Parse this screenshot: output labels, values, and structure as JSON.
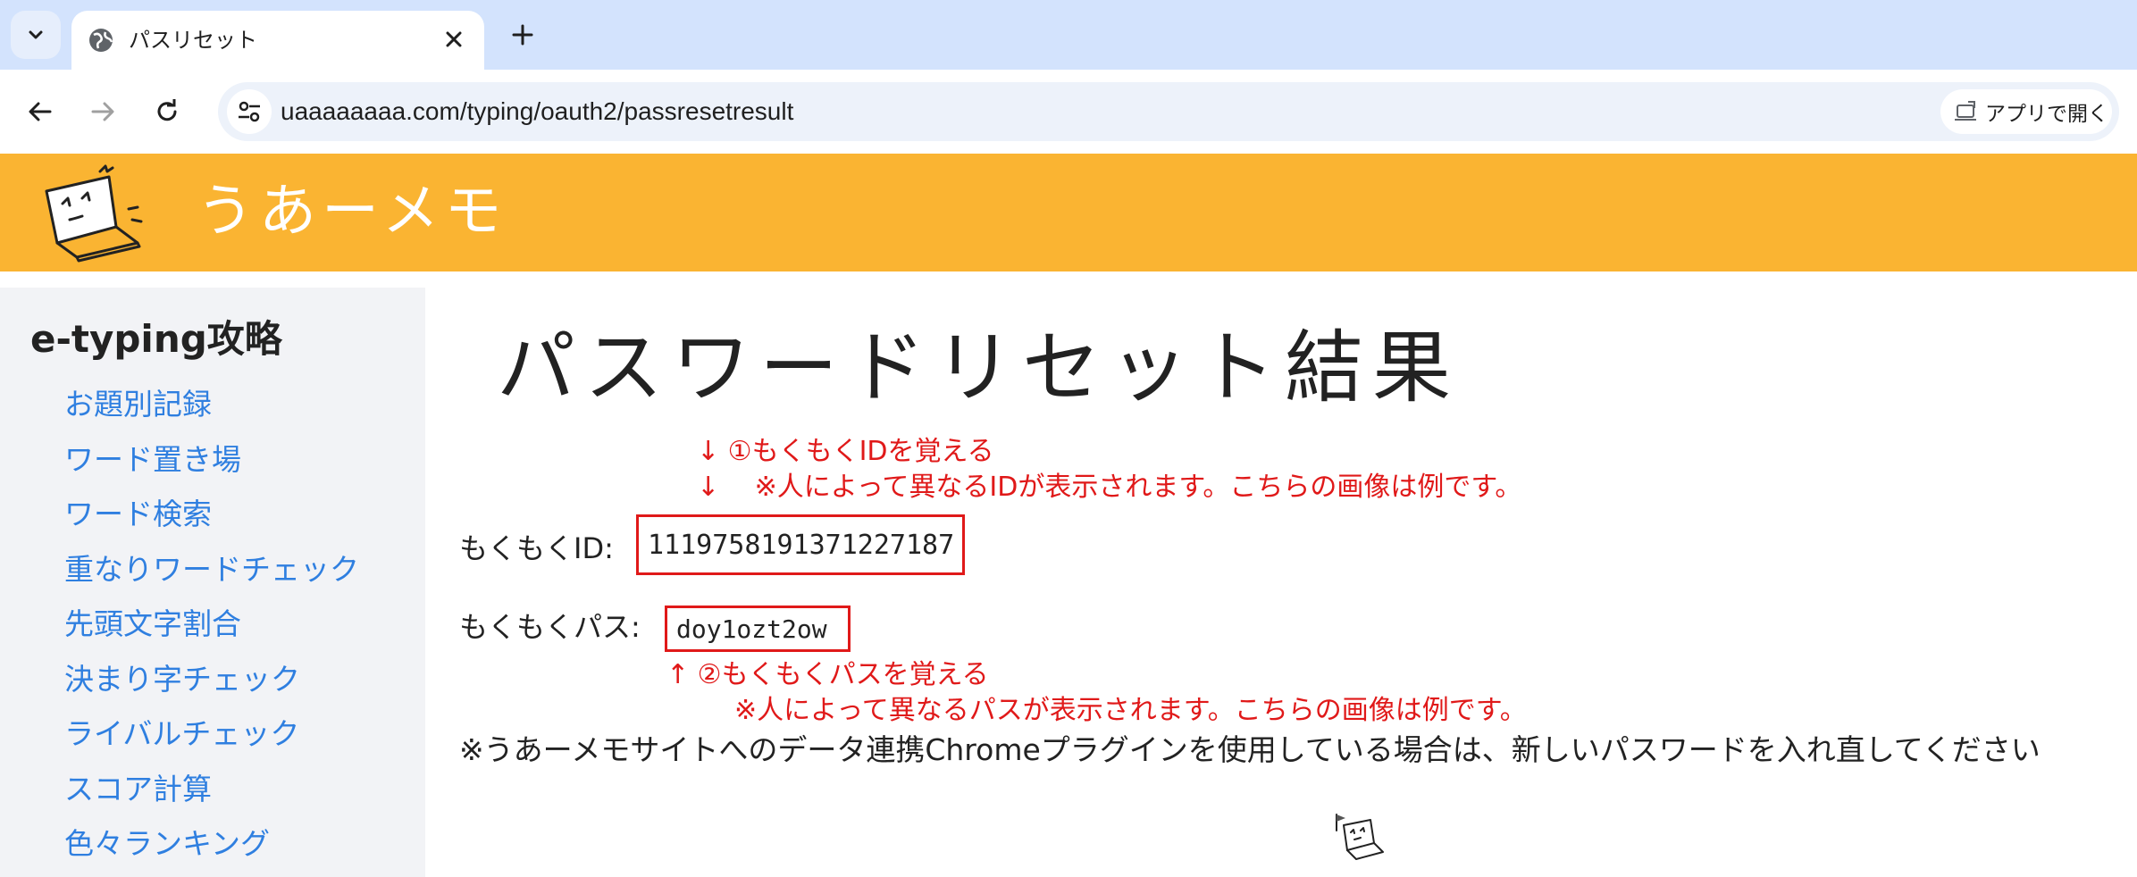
{
  "browser": {
    "tab_title": "パスリセット",
    "url": "uaaaaaaaa.com/typing/oauth2/passresetresult",
    "open_in_app_label": "アプリで開く"
  },
  "site": {
    "name": "うあーメモ",
    "header_color": "#fab432"
  },
  "sidebar": {
    "heading": "e-typing攻略",
    "items": [
      {
        "label": "お題別記録"
      },
      {
        "label": "ワード置き場"
      },
      {
        "label": "ワード検索"
      },
      {
        "label": "重なりワードチェック"
      },
      {
        "label": "先頭文字割合"
      },
      {
        "label": "決まり字チェック"
      },
      {
        "label": "ライバルチェック"
      },
      {
        "label": "スコア計算"
      },
      {
        "label": "色々ランキング"
      }
    ]
  },
  "main": {
    "title": "パスワードリセット結果",
    "note_id_1": "↓ ①もくもくIDを覚える",
    "note_id_2": "↓　 ※人によって異なるIDが表示されます。こちらの画像は例です。",
    "id_label": "もくもくID:",
    "id_value": "1119758191371227187",
    "pass_label": "もくもくパス:",
    "pass_value": "doy1ozt2ow",
    "note_pass_1": "↑ ②もくもくパスを覚える",
    "note_pass_2": "※人によって異なるパスが表示されます。こちらの画像は例です。",
    "chrome_note": "※うあーメモサイトへのデータ連携Chromeプラグインを使用している場合は、新しいパスワードを入れ直してください",
    "annotation_color": "#e01919"
  }
}
